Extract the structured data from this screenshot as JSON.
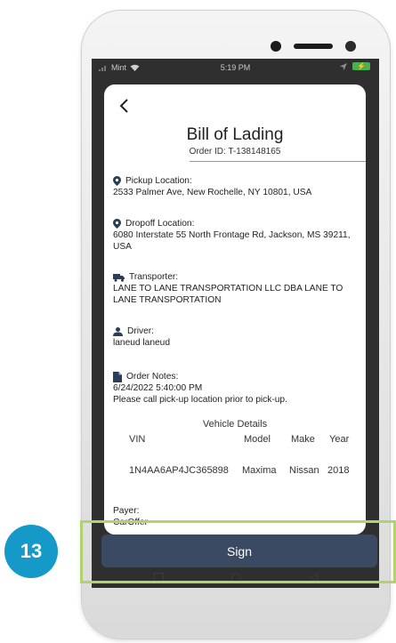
{
  "status_bar": {
    "carrier": "Mint",
    "time": "5:19 PM"
  },
  "page": {
    "title": "Bill of Lading",
    "order_id": "Order ID: T-138148165"
  },
  "pickup": {
    "label": "Pickup Location:",
    "value": "2533 Palmer Ave, New Rochelle, NY 10801, USA"
  },
  "dropoff": {
    "label": "Dropoff Location:",
    "value": "6080 Interstate 55 North Frontage Rd, Jackson, MS 39211, USA"
  },
  "transporter": {
    "label": "Transporter:",
    "value": "LANE TO LANE TRANSPORTATION LLC DBA LANE TO LANE TRANSPORTATION"
  },
  "driver": {
    "label": "Driver:",
    "value": "laneud laneud"
  },
  "order_notes": {
    "label": "Order Notes:",
    "date": "6/24/2022 5:40:00 PM",
    "text": "Please call pick-up location prior to pick-up."
  },
  "vehicle_details": {
    "title": "Vehicle Details",
    "columns": [
      "VIN",
      "Model",
      "Make",
      "Year"
    ],
    "rows": [
      {
        "vin": "1N4AA6AP4JC365898",
        "model": "Maxima",
        "make": "Nissan",
        "year": "2018"
      }
    ]
  },
  "payer": {
    "label": "Payer:",
    "value": "CarOffer"
  },
  "actions": {
    "sign_label": "Sign"
  },
  "tutorial": {
    "step_number": "13",
    "badge_color": "#1499c8",
    "highlight_color": "#b2d16f"
  },
  "colors": {
    "primary": "#3b4a63",
    "accent_line": "#6aa8b6"
  }
}
